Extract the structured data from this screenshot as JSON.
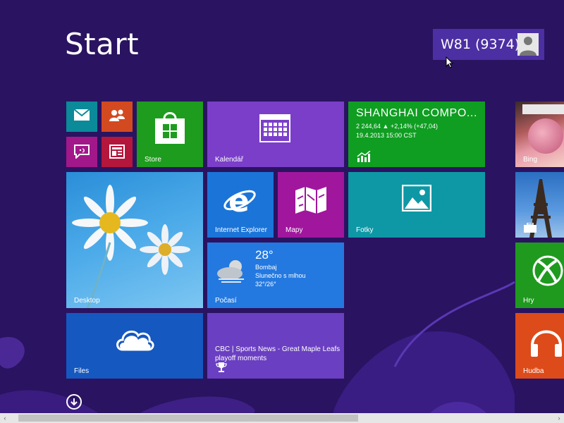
{
  "page": {
    "title": "Start"
  },
  "user": {
    "name": "W81 (9374)",
    "icon": "user-avatar-icon"
  },
  "tiles": {
    "mail": {
      "icon": "mail-icon",
      "color": "#0b8a9a"
    },
    "people": {
      "icon": "people-icon",
      "color": "#d34a20"
    },
    "messaging": {
      "icon": "messaging-icon",
      "color": "#a2188b"
    },
    "reader": {
      "icon": "reader-icon",
      "color": "#b4173b"
    },
    "store": {
      "label": "Store",
      "icon": "store-bag-icon",
      "color": "#1e9c1e"
    },
    "calendar": {
      "label": "Kalendář",
      "icon": "calendar-icon",
      "color": "#7a3ec8"
    },
    "finance": {
      "title": "SHANGHAI COMPO...",
      "value_line": "2 244,64 ▲ +2,14% (+47,04)",
      "date_line": "19.4.2013 15:00 CST",
      "icon": "finance-chart-icon",
      "color": "#0f9d22"
    },
    "bing": {
      "label": "Bing",
      "icon": "bing-photo"
    },
    "desktop": {
      "label": "Desktop",
      "icon": "daisy-wallpaper"
    },
    "ie": {
      "label": "Internet Explorer",
      "icon": "internet-explorer-icon",
      "color": "#1b75d9"
    },
    "maps": {
      "label": "Mapy",
      "icon": "maps-icon",
      "color": "#a0179e"
    },
    "photos": {
      "label": "Fotky",
      "icon": "photos-icon",
      "color": "#0e98a6"
    },
    "travel": {
      "icon": "suitcase-icon"
    },
    "weather": {
      "temp": "28°",
      "city": "Bombaj",
      "condition": "Slunečno s mlhou",
      "range": "32°/26°",
      "label": "Počasí",
      "icon": "weather-sun-fog-icon",
      "color": "#2479e0"
    },
    "games": {
      "label": "Hry",
      "icon": "xbox-controller-icon",
      "color": "#1f9a1f"
    },
    "files": {
      "label": "Files",
      "icon": "cloud-icon",
      "color": "#1558c0"
    },
    "sports": {
      "text": "CBC | Sports News - Great Maple Leafs playoff moments",
      "icon": "trophy-icon",
      "color": "#6a3fc1"
    },
    "music": {
      "label": "Hudba",
      "icon": "headphones-icon",
      "color": "#de4b1a"
    }
  },
  "apps_button": {
    "icon": "down-arrow-icon"
  },
  "scrollbar": {
    "left_icon": "scroll-left-icon",
    "right_icon": "scroll-right-icon",
    "left_glyph": "‹",
    "right_glyph": "›"
  }
}
